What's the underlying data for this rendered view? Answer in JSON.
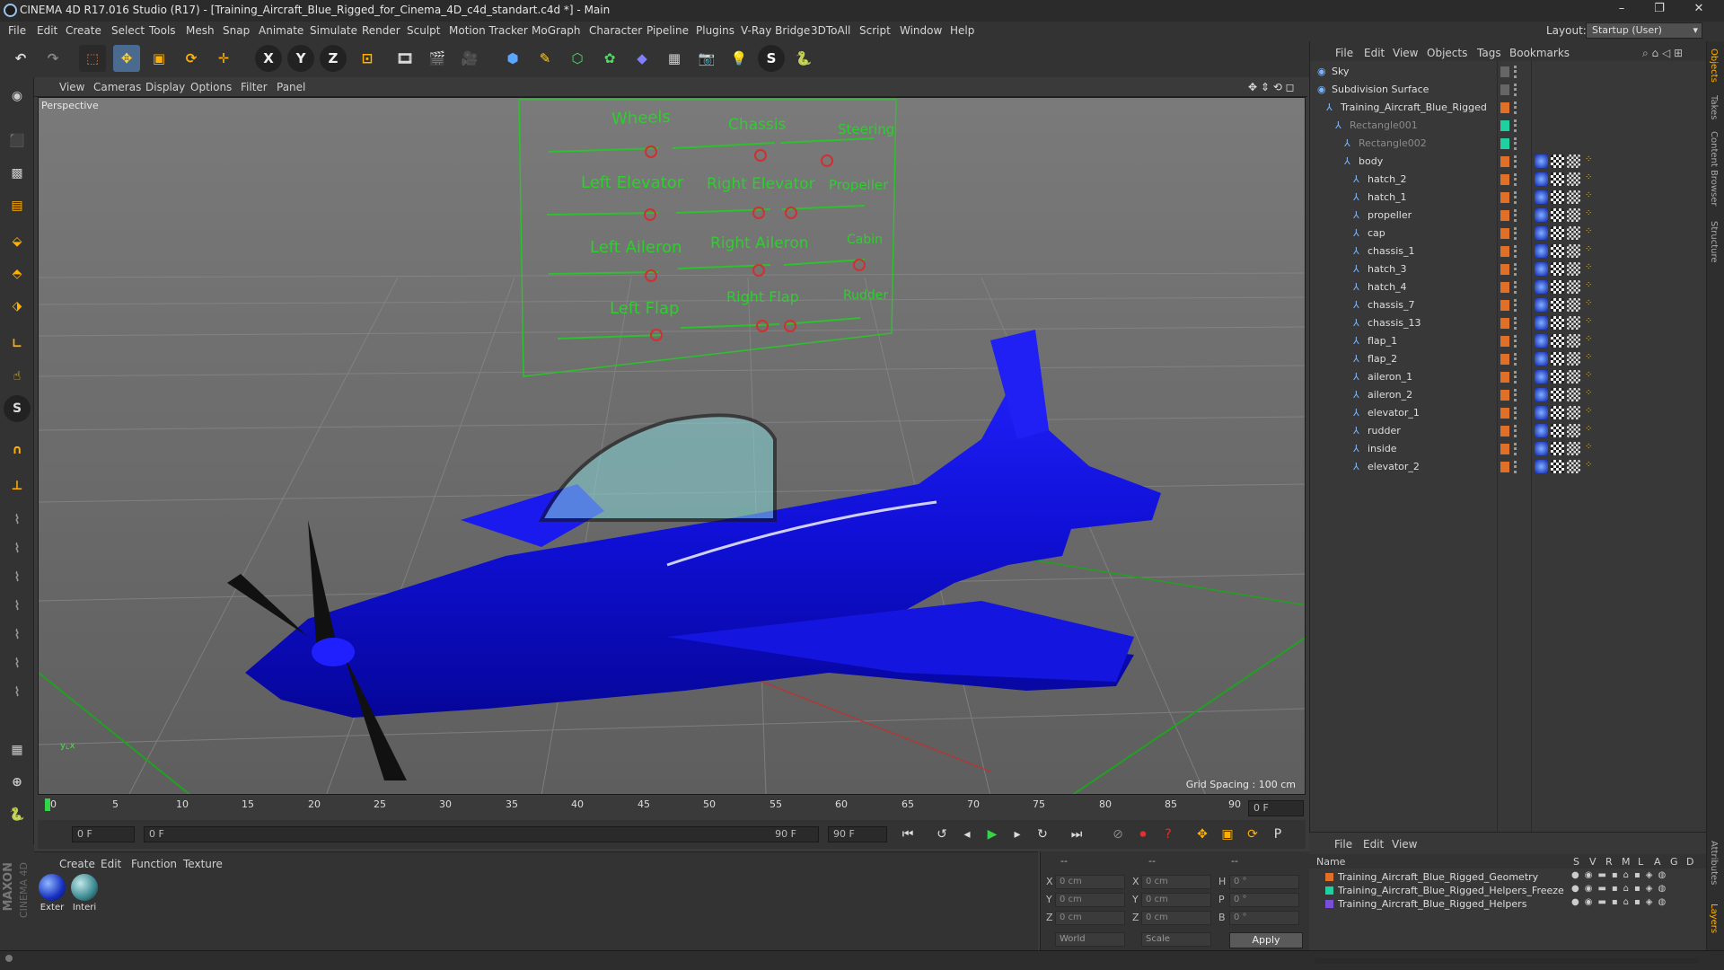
{
  "titlebar": {
    "title": "CINEMA 4D R17.016 Studio (R17) - [Training_Aircraft_Blue_Rigged_for_Cinema_4D_c4d_standart.c4d *] - Main"
  },
  "menu": [
    "File",
    "Edit",
    "Create",
    "Select",
    "Tools",
    "Mesh",
    "Snap",
    "Animate",
    "Simulate",
    "Render",
    "Sculpt",
    "Motion Tracker",
    "MoGraph",
    "Character",
    "Pipeline",
    "Plugins",
    "V-Ray Bridge",
    "3DToAll",
    "Script",
    "Window",
    "Help"
  ],
  "layout": {
    "label": "Layout:",
    "value": "Startup (User)"
  },
  "viewport_menu": [
    "View",
    "Cameras",
    "Display",
    "Options",
    "Filter",
    "Panel"
  ],
  "viewport": {
    "camera": "Perspective",
    "grid_spacing": "Grid Spacing : 100 cm"
  },
  "control_panel": {
    "labels": [
      "Wheels",
      "Chassis",
      "Steering",
      "Left Elevator",
      "Right Elevator",
      "Propeller",
      "Left Aileron",
      "Right Aileron",
      "Cabin",
      "Left Flap",
      "Right Flap",
      "Rudder"
    ]
  },
  "timeline": {
    "ticks": [
      "0",
      "5",
      "10",
      "15",
      "20",
      "25",
      "30",
      "35",
      "40",
      "45",
      "50",
      "55",
      "60",
      "65",
      "70",
      "75",
      "80",
      "85",
      "90"
    ],
    "frame_display": "0 F"
  },
  "transport": {
    "current_frame": "0 F",
    "range_start": "0 F",
    "range_end": "90 F",
    "end_frame": "90 F"
  },
  "material_panel": {
    "menu": [
      "Create",
      "Edit",
      "Function",
      "Texture"
    ],
    "materials": [
      {
        "name": "Exter"
      },
      {
        "name": "Interi"
      }
    ]
  },
  "coords": {
    "header": [
      "--",
      "--",
      "--"
    ],
    "rows": [
      {
        "a": "X",
        "av": "0 cm",
        "b": "X",
        "bv": "0 cm",
        "c": "H",
        "cv": "0 °"
      },
      {
        "a": "Y",
        "av": "0 cm",
        "b": "Y",
        "bv": "0 cm",
        "c": "P",
        "cv": "0 °"
      },
      {
        "a": "Z",
        "av": "0 cm",
        "b": "Z",
        "bv": "0 cm",
        "c": "B",
        "cv": "0 °"
      }
    ],
    "mode1": "World",
    "mode2": "Scale",
    "apply": "Apply"
  },
  "object_manager": {
    "menu": [
      "File",
      "Edit",
      "View",
      "Objects",
      "Tags",
      "Bookmarks"
    ],
    "objects": [
      {
        "name": "Sky",
        "indent": 0,
        "sw": "#666666"
      },
      {
        "name": "Subdivision Surface",
        "indent": 0,
        "sw": "#666666"
      },
      {
        "name": "Training_Aircraft_Blue_Rigged",
        "indent": 1,
        "sw": "#e07028"
      },
      {
        "name": "Rectangle001",
        "indent": 2,
        "sw": "#1fd1a0",
        "dim": true
      },
      {
        "name": "Rectangle002",
        "indent": 3,
        "sw": "#1fd1a0",
        "dim": true
      },
      {
        "name": "body",
        "indent": 3,
        "sw": "#e07028"
      },
      {
        "name": "hatch_2",
        "indent": 4,
        "sw": "#e07028"
      },
      {
        "name": "hatch_1",
        "indent": 4,
        "sw": "#e07028"
      },
      {
        "name": "propeller",
        "indent": 4,
        "sw": "#e07028"
      },
      {
        "name": "cap",
        "indent": 4,
        "sw": "#e07028"
      },
      {
        "name": "chassis_1",
        "indent": 4,
        "sw": "#e07028"
      },
      {
        "name": "hatch_3",
        "indent": 4,
        "sw": "#e07028"
      },
      {
        "name": "hatch_4",
        "indent": 4,
        "sw": "#e07028"
      },
      {
        "name": "chassis_7",
        "indent": 4,
        "sw": "#e07028"
      },
      {
        "name": "chassis_13",
        "indent": 4,
        "sw": "#e07028"
      },
      {
        "name": "flap_1",
        "indent": 4,
        "sw": "#e07028"
      },
      {
        "name": "flap_2",
        "indent": 4,
        "sw": "#e07028"
      },
      {
        "name": "aileron_1",
        "indent": 4,
        "sw": "#e07028"
      },
      {
        "name": "aileron_2",
        "indent": 4,
        "sw": "#e07028"
      },
      {
        "name": "elevator_1",
        "indent": 4,
        "sw": "#e07028"
      },
      {
        "name": "rudder",
        "indent": 4,
        "sw": "#e07028"
      },
      {
        "name": "inside",
        "indent": 4,
        "sw": "#e07028"
      },
      {
        "name": "elevator_2",
        "indent": 4,
        "sw": "#e07028"
      }
    ]
  },
  "layer_manager": {
    "menu": [
      "File",
      "Edit",
      "View"
    ],
    "columns": [
      "Name",
      "S",
      "V",
      "R",
      "M",
      "L",
      "A",
      "G",
      "D"
    ],
    "layers": [
      {
        "name": "Training_Aircraft_Blue_Rigged_Geometry",
        "color": "#e07028"
      },
      {
        "name": "Training_Aircraft_Blue_Rigged_Helpers_Freeze",
        "color": "#1fd1a0"
      },
      {
        "name": "Training_Aircraft_Blue_Rigged_Helpers",
        "color": "#7a4fd8"
      }
    ]
  },
  "right_tabs": [
    "Objects",
    "Takes",
    "Content Browser",
    "Structure",
    "Attributes",
    "Layers"
  ],
  "brand": {
    "maxon": "MAXON",
    "product": "CINEMA 4D"
  }
}
